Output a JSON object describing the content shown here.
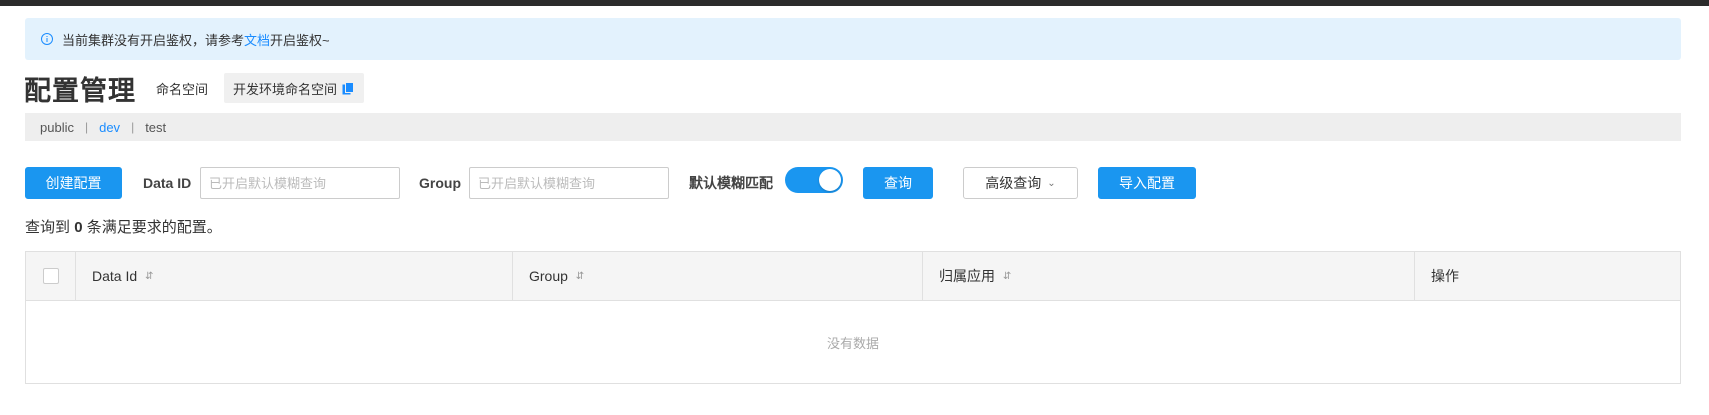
{
  "notice": {
    "prefix": "当前集群没有开启鉴权，请参考",
    "link": "文档",
    "suffix": "开启鉴权~"
  },
  "header": {
    "title": "配置管理",
    "namespace_label": "命名空间",
    "namespace_value": "开发环境命名空间"
  },
  "namespaces": [
    "public",
    "dev",
    "test"
  ],
  "toolbar": {
    "create_label": "创建配置",
    "data_id_label": "Data ID",
    "data_id_placeholder": "已开启默认模糊查询",
    "group_label": "Group",
    "group_placeholder": "已开启默认模糊查询",
    "fuzzy_label": "默认模糊匹配",
    "fuzzy_enabled": true,
    "query_label": "查询",
    "advanced_label": "高级查询",
    "import_label": "导入配置"
  },
  "result": {
    "prefix": "查询到",
    "count": "0",
    "suffix": "条满足要求的配置。"
  },
  "table": {
    "columns": [
      "Data Id",
      "Group",
      "归属应用",
      "操作"
    ],
    "empty_text": "没有数据"
  },
  "colors": {
    "primary": "#1a96f0",
    "link": "#1a8cff",
    "notice_bg": "#e3f2fd"
  }
}
